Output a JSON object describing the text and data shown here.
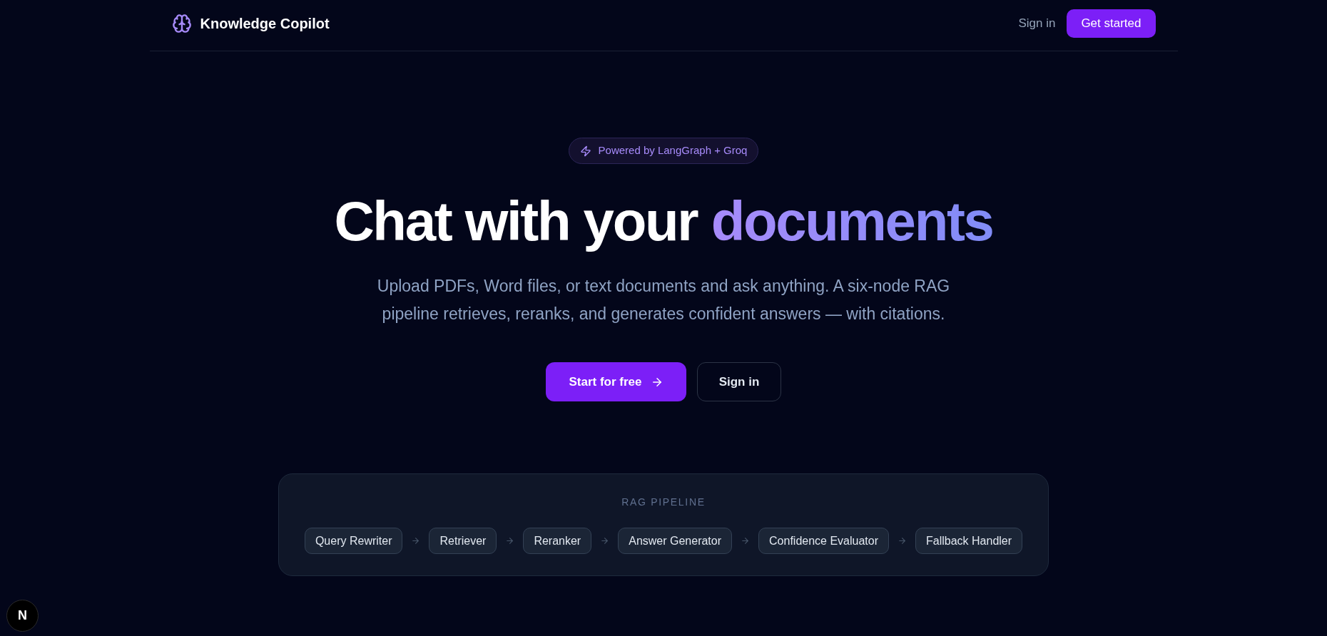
{
  "header": {
    "brand": "Knowledge Copilot",
    "nav": [
      {
        "label": "Sign in",
        "kind": "link"
      },
      {
        "label": "Get started",
        "kind": "primary"
      }
    ]
  },
  "hero": {
    "badge": "Powered by LangGraph + Groq",
    "title": "Chat with your",
    "title_highlight": "documents",
    "description": "Upload PDFs, Word files, or text documents and ask anything. A six-node RAG pipeline retrieves, reranks, and generates confident answers — with citations.",
    "buttons": [
      {
        "label": "Start for free",
        "kind": "primary"
      },
      {
        "label": "Sign in",
        "kind": "outline"
      }
    ]
  },
  "pipeline": {
    "title": "RAG PIPELINE",
    "steps": [
      "Query Rewriter",
      "Retriever",
      "Reranker",
      "Answer Generator",
      "Confidence Evaluator",
      "Fallback Handler"
    ]
  },
  "dev_indicator": {
    "label": "N"
  }
}
